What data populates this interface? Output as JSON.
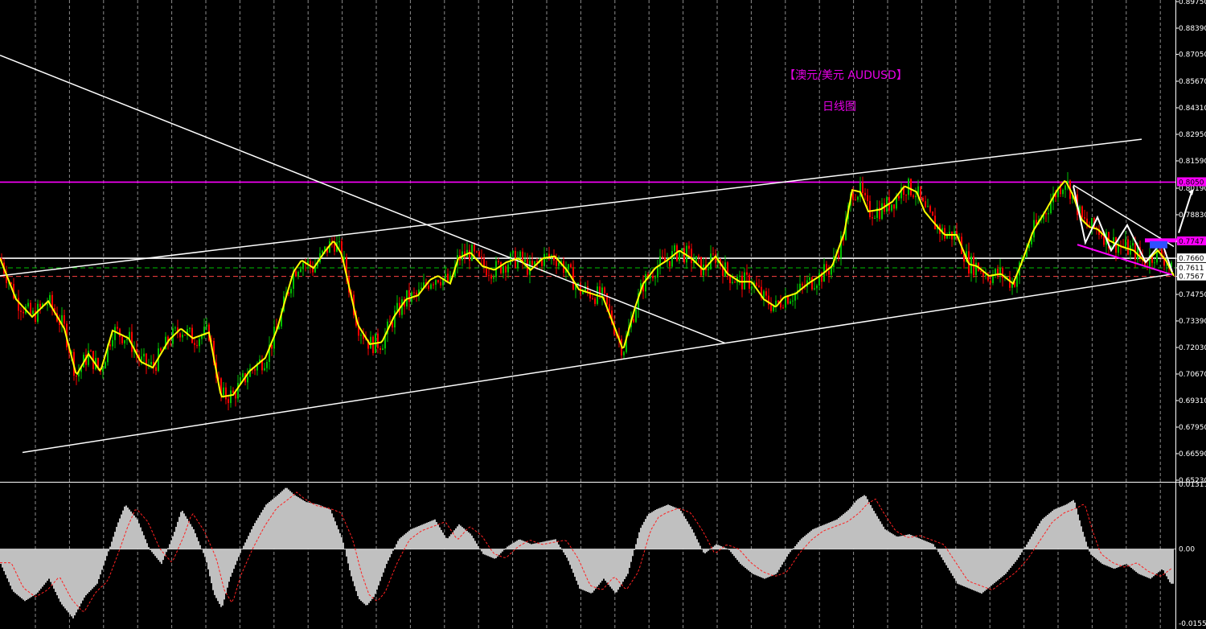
{
  "chart_data": {
    "type": "line",
    "symbol": "AUDUSD",
    "annotations": {
      "title": "【澳元/美元 AUDUSD】",
      "subtitle": "日线图",
      "title_color": "#e600e6"
    },
    "colors": {
      "background": "#000000",
      "grid": "#ffffff",
      "candle_up": "#00c000",
      "candle_down": "#ff0000",
      "moving_average": "#ffff00",
      "trendline": "#ffffff",
      "resistance": "#ff00ff",
      "histogram": "#c0c0c0",
      "signal": "#ff2020"
    },
    "price_axis": {
      "ylim": [
        0.6523,
        0.8975
      ],
      "ticks": [
        "0.89750",
        "0.88390",
        "0.87050",
        "0.85670",
        "0.84310",
        "0.82950",
        "0.81590",
        "0.80190",
        "0.78830",
        "0.77470",
        "0.76600",
        "0.76110",
        "0.75671",
        "0.74750",
        "0.73390",
        "0.72030",
        "0.70670",
        "0.69310",
        "0.67950",
        "0.66590",
        "0.65230"
      ],
      "price_labels": [
        {
          "value": 0.805,
          "text": "0.8050",
          "color": "#ff00ff"
        },
        {
          "value": 0.7747,
          "text": "0.7747",
          "color": "#ff00ff"
        },
        {
          "value": 0.766,
          "text": "0.7660",
          "color": "#ffffff"
        },
        {
          "value": 0.7611,
          "text": "0.7611",
          "color": "#ffffff"
        },
        {
          "value": 0.75671,
          "text": "0.7567",
          "color": "#ffffff"
        }
      ]
    },
    "horizontal_levels": [
      {
        "value": 0.805,
        "style": "solid",
        "color": "#ff00ff"
      },
      {
        "value": 0.766,
        "style": "solid",
        "color": "#ffffff"
      },
      {
        "value": 0.7611,
        "style": "dashed",
        "color": "#00c000"
      },
      {
        "value": 0.75671,
        "style": "dashed",
        "color": "#ff4040"
      }
    ],
    "ma_series": {
      "name": "",
      "x": [
        0,
        20,
        40,
        60,
        80,
        95,
        110,
        125,
        140,
        160,
        175,
        190,
        210,
        225,
        240,
        260,
        275,
        290,
        310,
        330,
        345,
        355,
        365,
        375,
        390,
        405,
        415,
        425,
        435,
        445,
        460,
        475,
        490,
        505,
        520,
        535,
        545,
        560,
        570,
        585,
        600,
        615,
        630,
        645,
        660,
        675,
        690,
        705,
        720,
        735,
        750,
        765,
        775,
        790,
        800,
        815,
        830,
        845,
        860,
        875,
        890,
        905,
        920,
        935,
        950,
        965,
        975,
        990,
        1005,
        1020,
        1035,
        1050,
        1060,
        1070,
        1080,
        1095,
        1110,
        1125,
        1140,
        1150,
        1160,
        1175,
        1190,
        1205,
        1215,
        1230,
        1245,
        1260,
        1270,
        1285,
        1300,
        1315,
        1325,
        1335,
        1345,
        1355,
        1365,
        1380,
        1395,
        1410,
        1425,
        1440,
        1450,
        1460
      ],
      "y": [
        0.766,
        0.745,
        0.736,
        0.744,
        0.73,
        0.706,
        0.717,
        0.708,
        0.729,
        0.725,
        0.713,
        0.71,
        0.724,
        0.73,
        0.725,
        0.728,
        0.695,
        0.696,
        0.708,
        0.715,
        0.73,
        0.745,
        0.759,
        0.765,
        0.761,
        0.77,
        0.775,
        0.768,
        0.75,
        0.732,
        0.722,
        0.723,
        0.736,
        0.745,
        0.747,
        0.755,
        0.757,
        0.753,
        0.766,
        0.769,
        0.762,
        0.76,
        0.764,
        0.766,
        0.76,
        0.766,
        0.767,
        0.76,
        0.75,
        0.748,
        0.746,
        0.73,
        0.719,
        0.741,
        0.753,
        0.761,
        0.765,
        0.77,
        0.766,
        0.76,
        0.767,
        0.758,
        0.754,
        0.754,
        0.745,
        0.741,
        0.746,
        0.748,
        0.753,
        0.757,
        0.762,
        0.779,
        0.801,
        0.8,
        0.79,
        0.791,
        0.795,
        0.803,
        0.8,
        0.79,
        0.785,
        0.778,
        0.778,
        0.763,
        0.762,
        0.757,
        0.758,
        0.753,
        0.763,
        0.78,
        0.79,
        0.801,
        0.806,
        0.798,
        0.786,
        0.782,
        0.781,
        0.775,
        0.772,
        0.77,
        0.764,
        0.77,
        0.765,
        0.757
      ]
    },
    "trendlines": [
      {
        "x1": 0,
        "y1": 0.87,
        "x2": 902,
        "y2": 0.7225
      },
      {
        "x1": 0,
        "y1": 0.757,
        "x2": 1420,
        "y2": 0.827
      },
      {
        "x1": 28,
        "y1": 0.6665,
        "x2": 902,
        "y2": 0.7225
      },
      {
        "x1": 902,
        "y1": 0.7225,
        "x2": 1460,
        "y2": 0.758
      },
      {
        "x1": 1335,
        "y1": 0.8035,
        "x2": 1460,
        "y2": 0.772
      }
    ],
    "oscillator": {
      "ylim": [
        -0.0155,
        0.01311
      ],
      "ticks": [
        "0.01311",
        "0.00",
        "-0.0155"
      ],
      "x": [
        0,
        15,
        30,
        45,
        60,
        75,
        90,
        105,
        120,
        135,
        145,
        155,
        170,
        185,
        200,
        215,
        225,
        240,
        255,
        265,
        275,
        285,
        300,
        315,
        330,
        345,
        355,
        365,
        380,
        395,
        410,
        425,
        435,
        445,
        455,
        465,
        480,
        495,
        510,
        525,
        540,
        555,
        570,
        585,
        600,
        615,
        630,
        645,
        660,
        675,
        690,
        705,
        720,
        735,
        750,
        765,
        780,
        795,
        805,
        815,
        830,
        845,
        860,
        875,
        890,
        905,
        920,
        935,
        950,
        965,
        980,
        995,
        1010,
        1025,
        1040,
        1055,
        1065,
        1075,
        1085,
        1100,
        1115,
        1130,
        1145,
        1160,
        1175,
        1190,
        1205,
        1220,
        1235,
        1250,
        1265,
        1280,
        1295,
        1310,
        1325,
        1335,
        1345,
        1355,
        1370,
        1385,
        1400,
        1415,
        1430,
        1445,
        1455
      ],
      "values": [
        -0.003,
        -0.0085,
        -0.0105,
        -0.009,
        -0.006,
        -0.011,
        -0.014,
        -0.0095,
        -0.007,
        0.0,
        0.005,
        0.009,
        0.006,
        0.0,
        -0.003,
        0.003,
        0.008,
        0.004,
        -0.002,
        -0.009,
        -0.012,
        -0.006,
        0.0,
        0.005,
        0.009,
        0.011,
        0.0125,
        0.011,
        0.0095,
        0.009,
        0.008,
        0.002,
        -0.005,
        -0.01,
        -0.0115,
        -0.0095,
        -0.003,
        0.002,
        0.004,
        0.005,
        0.006,
        0.002,
        0.005,
        0.003,
        -0.001,
        -0.002,
        0.0005,
        0.002,
        0.001,
        0.0015,
        0.002,
        -0.002,
        -0.008,
        -0.009,
        -0.006,
        -0.009,
        -0.005,
        0.004,
        0.007,
        0.008,
        0.009,
        0.008,
        0.004,
        -0.001,
        0.001,
        0.0,
        -0.003,
        -0.005,
        -0.006,
        -0.005,
        -0.001,
        0.002,
        0.004,
        0.005,
        0.006,
        0.008,
        0.01,
        0.011,
        0.008,
        0.004,
        0.0025,
        0.003,
        0.002,
        0.001,
        -0.003,
        -0.007,
        -0.008,
        -0.009,
        -0.007,
        -0.005,
        -0.002,
        0.002,
        0.006,
        0.008,
        0.009,
        0.01,
        0.004,
        -0.001,
        -0.003,
        -0.004,
        -0.003,
        -0.005,
        -0.006,
        -0.004,
        -0.007
      ]
    }
  }
}
